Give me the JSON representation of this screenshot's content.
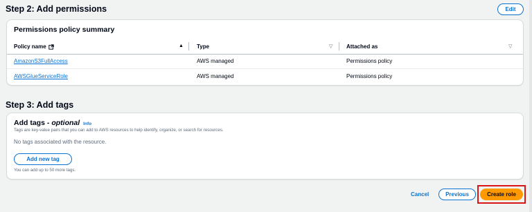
{
  "step2": {
    "title": "Step 2: Add permissions",
    "edit_label": "Edit",
    "summary_title": "Permissions policy summary",
    "columns": [
      "Policy name",
      "Type",
      "Attached as"
    ],
    "rows": [
      {
        "name": "AmazonS3FullAccess",
        "type": "AWS managed",
        "attached": "Permissions policy"
      },
      {
        "name": "AWSGlueServiceRole",
        "type": "AWS managed",
        "attached": "Permissions policy"
      }
    ]
  },
  "step3": {
    "title": "Step 3: Add tags",
    "heading": "Add tags -",
    "optional": "optional",
    "info": "Info",
    "description": "Tags are key-value pairs that you can add to AWS resources to help identify, organize, or search for resources.",
    "empty": "No tags associated with the resource.",
    "add_label": "Add new tag",
    "limit_note": "You can add up to 50 more tags."
  },
  "footer": {
    "cancel": "Cancel",
    "previous": "Previous",
    "create": "Create role"
  },
  "icons": {
    "external_link": "external-link-icon",
    "sort_asc": "sort-ascending-icon",
    "sort_default": "caret-down-icon"
  },
  "colors": {
    "link": "#0972d3",
    "primary_button": "#ff9900",
    "highlight": "#d91515"
  }
}
